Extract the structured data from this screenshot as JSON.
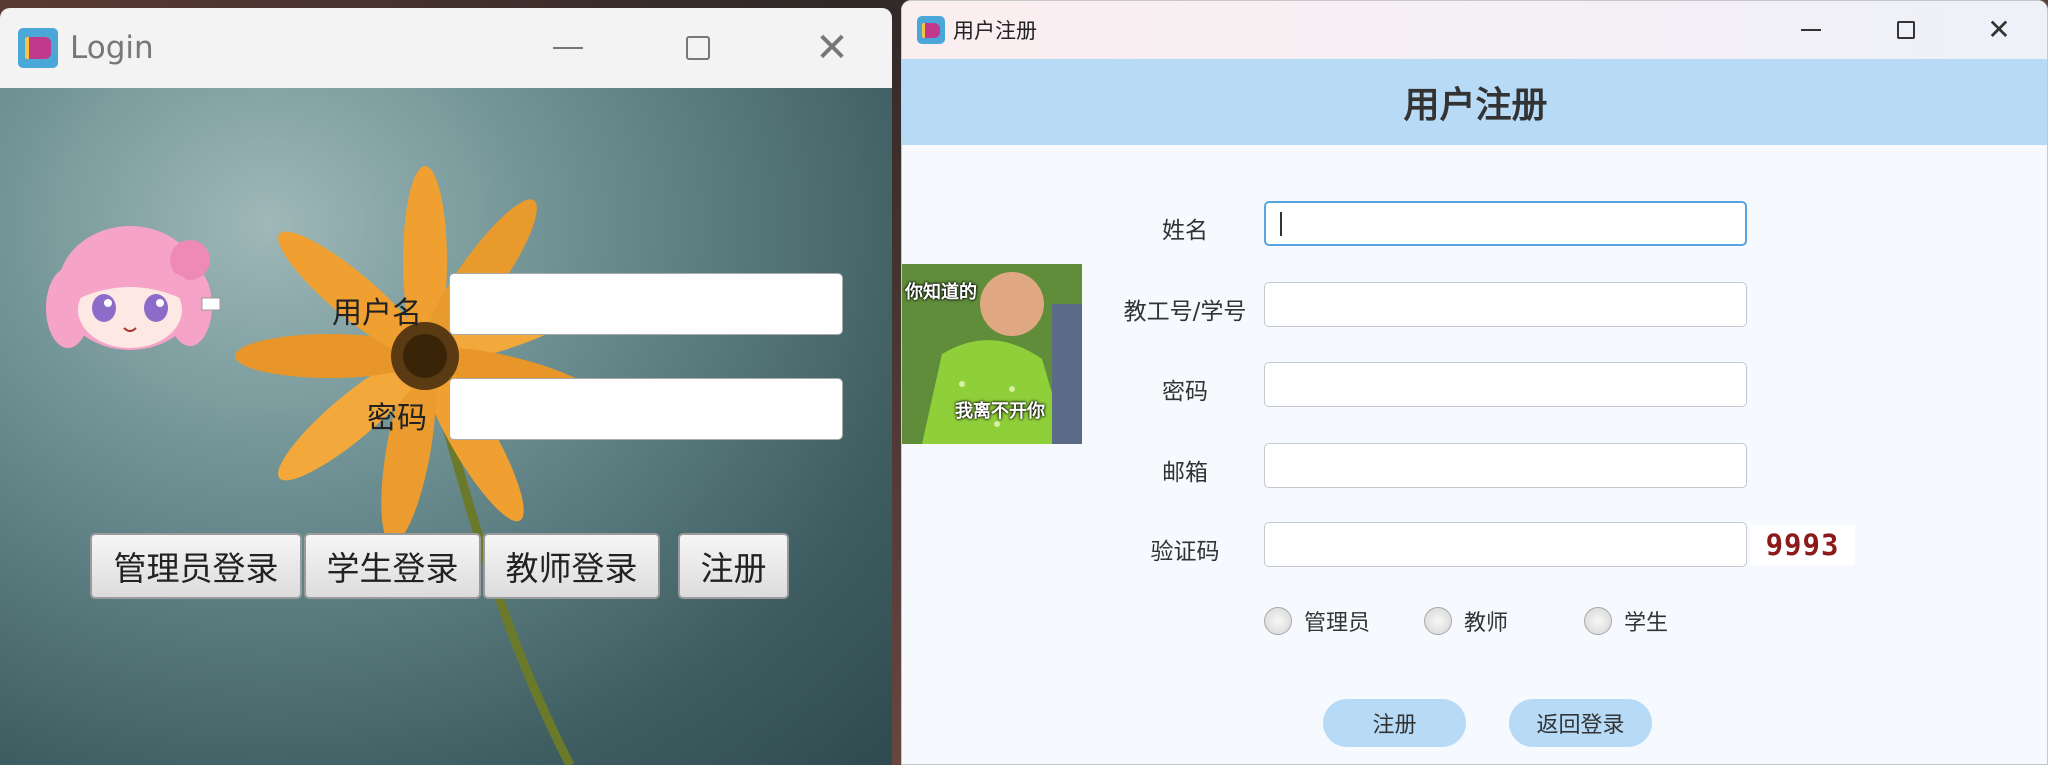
{
  "login_window": {
    "title": "Login",
    "icon": "book-app-icon",
    "username_label": "用户名",
    "password_label": "密码",
    "username_value": "",
    "password_value": "",
    "buttons": {
      "admin_login": "管理员登录",
      "student_login": "学生登录",
      "teacher_login": "教师登录",
      "register": "注册"
    }
  },
  "register_window": {
    "title": "用户注册",
    "icon": "book-app-icon",
    "header": "用户注册",
    "fields": {
      "name_label": "姓名",
      "id_label": "教工号/学号",
      "password_label": "密码",
      "email_label": "邮箱",
      "captcha_label": "验证码"
    },
    "values": {
      "name": "",
      "id": "",
      "password": "",
      "email": "",
      "captcha": ""
    },
    "captcha_code": "9993",
    "roles": {
      "admin": "管理员",
      "teacher": "教师",
      "student": "学生"
    },
    "buttons": {
      "register": "注册",
      "back_to_login": "返回登录"
    },
    "meme_text": {
      "top": "你知道的",
      "bottom": "我离不开你"
    }
  },
  "colors": {
    "accent": "#b7dbf6",
    "focus_border": "#57a5e0",
    "captcha_text": "#8c1a1a"
  }
}
